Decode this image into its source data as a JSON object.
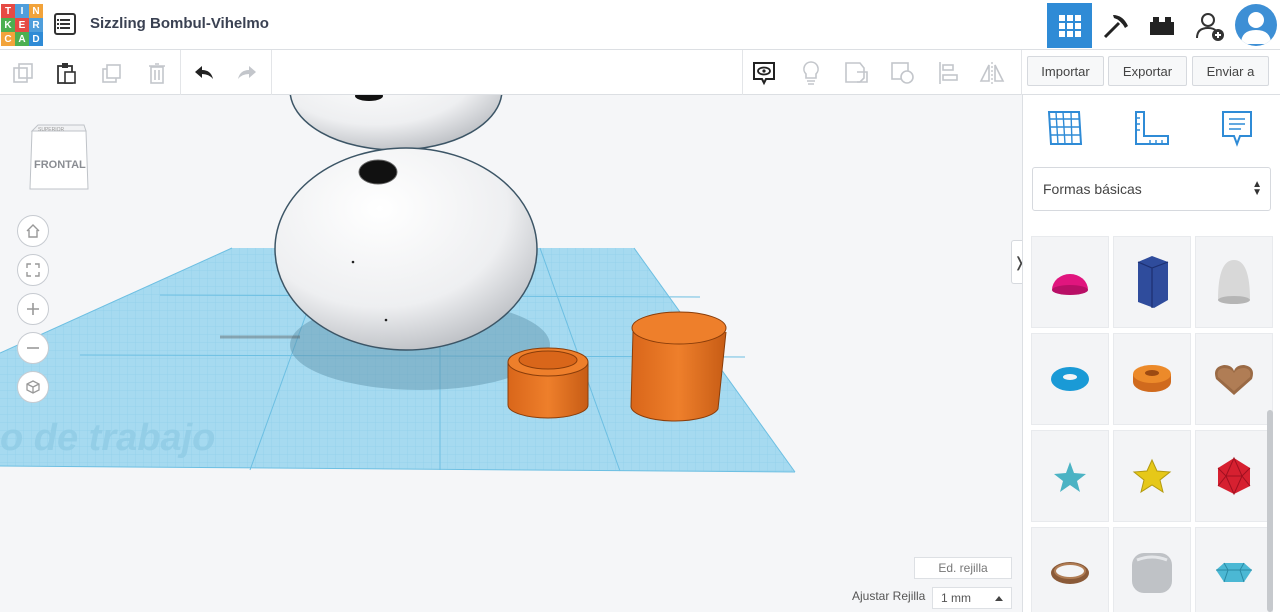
{
  "header": {
    "logo_letters": [
      "T",
      "I",
      "N",
      "K",
      "E",
      "R",
      "C",
      "A",
      "D"
    ],
    "logo_colors": [
      "#e64a44",
      "#4f9edb",
      "#f2a33a",
      "#4caf50",
      "#e64a44",
      "#4f9edb",
      "#f2a33a",
      "#4caf50",
      "#2f8bd6"
    ],
    "design_title": "Sizzling Bombul-Vihelmo",
    "view_buttons": [
      "grid-view-icon",
      "pickaxe-icon",
      "brick-icon",
      "add-user-icon"
    ]
  },
  "toolbar": {
    "tools": [
      "copy-icon",
      "paste-icon",
      "duplicate-icon",
      "delete-icon",
      "undo-icon",
      "redo-icon"
    ],
    "right_tools": [
      "notes-icon",
      "light-bulb-icon",
      "group-icon",
      "ungroup-icon",
      "align-icon",
      "mirror-icon"
    ],
    "import_label": "Importar",
    "export_label": "Exportar",
    "send_label": "Enviar a"
  },
  "workplane": {
    "viewcube_label": "FRONTAL",
    "viewcube_top_label": "SUPERIOR",
    "plane_text": "o de trabajo",
    "edit_grid_label": "Ed. rejilla",
    "snap_grid_label": "Ajustar Rejilla",
    "snap_grid_value": "1 mm",
    "nav_buttons": [
      "home-icon",
      "fit-view-icon",
      "zoom-in-icon",
      "zoom-out-icon",
      "perspective-icon"
    ]
  },
  "sidepanel": {
    "panel_icons": [
      "workplane-icon",
      "ruler-icon",
      "notes-panel-icon"
    ],
    "category_selected": "Formas básicas",
    "shapes": [
      {
        "name": "half-sphere",
        "color": "#e0157e"
      },
      {
        "name": "polygon",
        "color": "#2f4c9c"
      },
      {
        "name": "paraboloid",
        "color": "#d8d8d8"
      },
      {
        "name": "torus",
        "color": "#1a9ad6"
      },
      {
        "name": "tube",
        "color": "#ec8a2a"
      },
      {
        "name": "heart",
        "color": "#9a6a45"
      },
      {
        "name": "star",
        "color": "#4bb3c4"
      },
      {
        "name": "star-yellow",
        "color": "#e6c818"
      },
      {
        "name": "icosahedron",
        "color": "#d62030"
      },
      {
        "name": "ring",
        "color": "#8a5a38"
      },
      {
        "name": "rounded-box",
        "color": "#bfc2c6"
      },
      {
        "name": "diamond",
        "color": "#4bb8d4"
      }
    ]
  },
  "colors": {
    "accent": "#2f8bd6",
    "orange": "#ec7a23",
    "grid": "#8fd2ee"
  }
}
